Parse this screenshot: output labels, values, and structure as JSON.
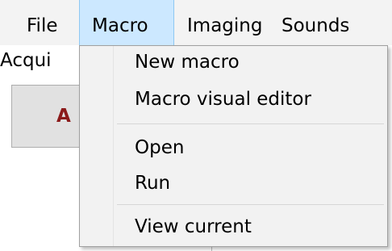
{
  "menubar": {
    "items": [
      {
        "label": "File"
      },
      {
        "label": "Macro"
      },
      {
        "label": "Imaging"
      },
      {
        "label": "Sounds"
      }
    ]
  },
  "background": {
    "section_label": "Acqui",
    "button_label": "A"
  },
  "dropdown": {
    "items": [
      {
        "label": "New macro"
      },
      {
        "label": "Macro visual editor"
      },
      {
        "label": "Open"
      },
      {
        "label": "Run"
      },
      {
        "label": "View current"
      }
    ]
  }
}
